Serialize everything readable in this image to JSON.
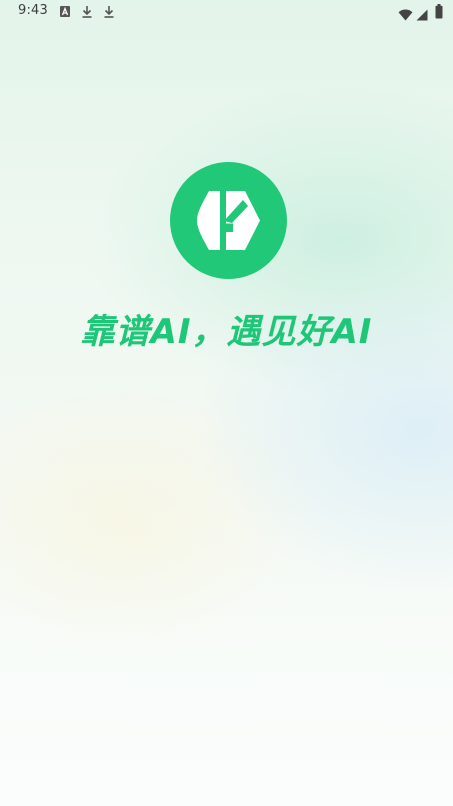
{
  "status_bar": {
    "time": "9:43",
    "left_icons": [
      "font-download-icon",
      "download-icon",
      "download-icon"
    ],
    "right_icons": [
      "wifi-icon",
      "signal-icon",
      "battery-icon"
    ]
  },
  "brand": {
    "logo_icon": "kaopu-k-logo-icon",
    "slogan": "靠谱AI，遇见好AI",
    "accent_color": "#20c878"
  }
}
